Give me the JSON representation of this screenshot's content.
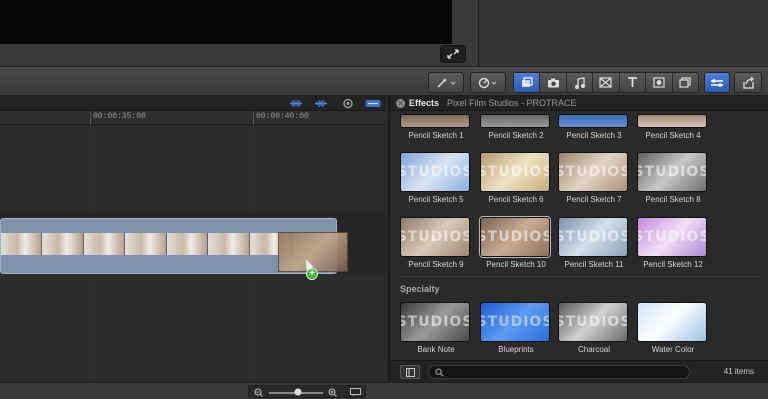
{
  "viewer": {},
  "toolbar": {
    "tools": [
      "magic-wand",
      "retime",
      "browser-clip",
      "photos",
      "music",
      "transitions",
      "titles",
      "generators",
      "themes",
      "inspector",
      "share"
    ]
  },
  "timeline": {
    "timecodes": [
      "00:00:35:00",
      "00:00:40:00"
    ],
    "clip": {
      "frames": 7
    }
  },
  "effects": {
    "title": "Effects",
    "breadcrumb": "Pixel Film Studios - PROTRACE",
    "items_row1": [
      "Pencil Sketch 1",
      "Pencil Sketch 2",
      "Pencil Sketch 3",
      "Pencil Sketch 4"
    ],
    "items_row2": [
      "Pencil Sketch 5",
      "Pencil Sketch 6",
      "Pencil Sketch 7",
      "Pencil Sketch 8"
    ],
    "items_row3": [
      "Pencil Sketch 9",
      "Pencil Sketch 10",
      "Pencil Sketch 11",
      "Pencil Sketch 12"
    ],
    "section": "Specialty",
    "specialty_items": [
      "Bank Note",
      "Blueprints",
      "Charcoal",
      "Water Color"
    ],
    "count": "41 items"
  },
  "colors": {
    "accent": "#3d6fcf",
    "clip": "#7d92a8",
    "add": "#3db83d"
  }
}
